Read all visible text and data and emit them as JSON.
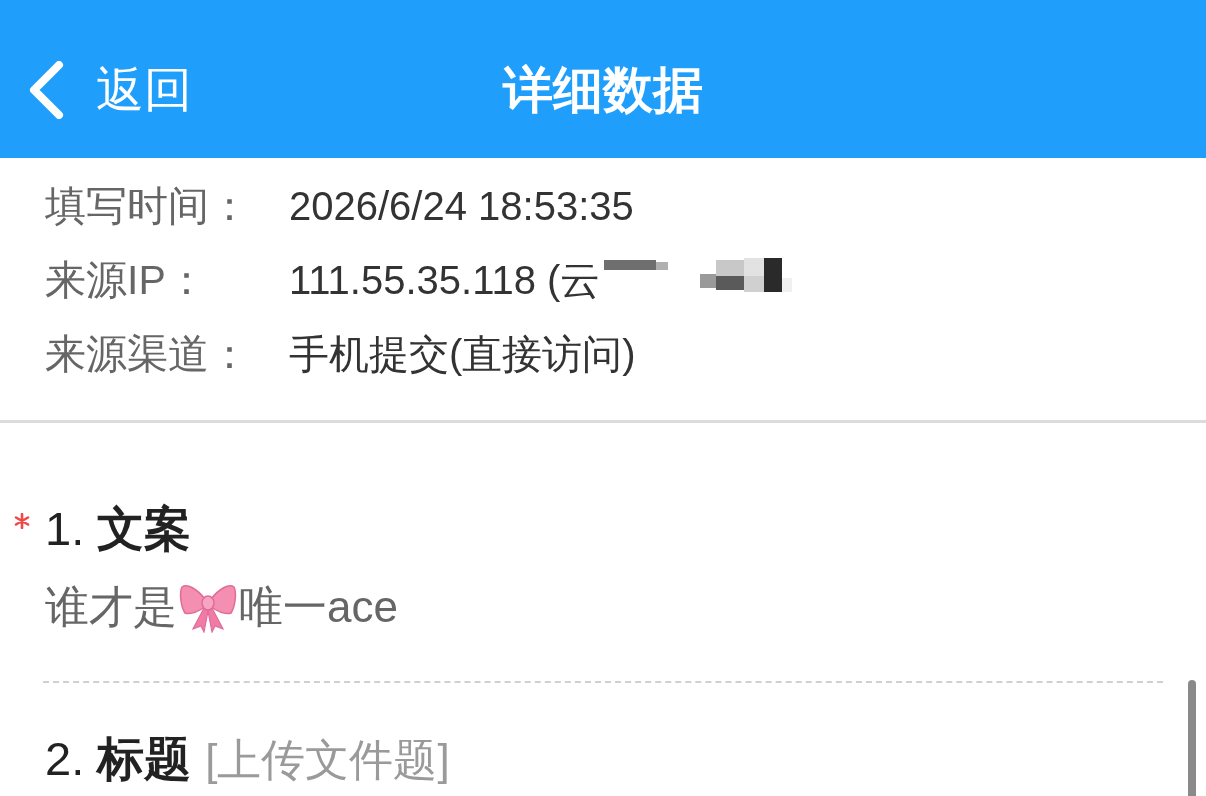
{
  "header": {
    "back_label": "返回",
    "title": "详细数据"
  },
  "info": [
    {
      "label": "填写时间：",
      "value": "2026/6/24 18:53:35",
      "redacted": false
    },
    {
      "label": "来源IP：",
      "value": "111.55.35.118 (云",
      "redacted": true
    },
    {
      "label": "来源渠道：",
      "value": "手机提交(直接访问)",
      "redacted": false
    }
  ],
  "questions": [
    {
      "title": "1. **文案**",
      "required": true,
      "answer": [
        {
          "kind": "text",
          "text": "谁才是"
        },
        {
          "kind": "emoji"
        },
        {
          "kind": "text",
          "text": "唯一ace"
        }
      ]
    },
    {
      "title": "2. **标题**",
      "type_hint": "[上传文件题]",
      "required": false
    }
  ]
}
